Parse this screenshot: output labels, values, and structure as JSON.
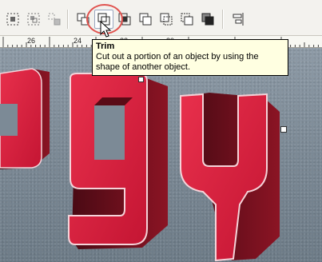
{
  "tooltip": {
    "title": "Trim",
    "description": "Cut out a portion of an object by using the shape of another object."
  },
  "ruler": {
    "labels": [
      "26",
      "24",
      "22",
      "20"
    ]
  },
  "toolbar": {
    "active_tool": "trim"
  },
  "artwork": {
    "letters": "ogy",
    "face_color": "#d8203d",
    "extrude_color": "#6b0e1b"
  }
}
